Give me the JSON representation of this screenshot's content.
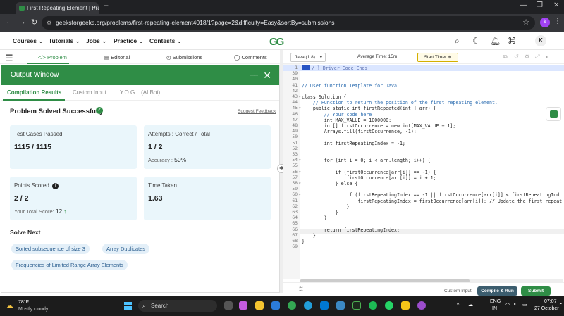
{
  "browser": {
    "tab_title": "First Repeating Element | Practi",
    "url": "geeksforgeeks.org/problems/first-repeating-element4018/1?page=2&difficulty=Easy&sortBy=submissions",
    "profile_initial": "k"
  },
  "site": {
    "logo": "GG",
    "nav": [
      "Courses",
      "Tutorials",
      "Jobs",
      "Practice",
      "Contests"
    ],
    "avatar_initial": "K"
  },
  "problem_tabs": [
    "Problem",
    "Editorial",
    "Submissions",
    "Comments"
  ],
  "output": {
    "title": "Output Window",
    "tabs": [
      "Compilation Results",
      "Custom Input",
      "Y.O.G.I. (AI Bot)"
    ],
    "status": "Problem Solved Successfully",
    "feedback": "Suggest Feedback",
    "cards": {
      "tests_label": "Test Cases Passed",
      "tests_value": "1115 / 1115",
      "attempts_label": "Attempts : Correct / Total",
      "attempts_value": "1 / 2",
      "accuracy_label": "Accuracy :",
      "accuracy_value": "50%",
      "points_label": "Points Scored",
      "points_value": "2 / 2",
      "total_label": "Your Total Score:",
      "total_value": "12",
      "time_label": "Time Taken",
      "time_value": "1.63"
    },
    "solve_next_title": "Solve Next",
    "solve_next": [
      "Sorted subsequence of size 3",
      "Array Duplicates",
      "Frequencies of Limited Range Array Elements"
    ]
  },
  "editor": {
    "language": "Java (1.8)",
    "avg_time": "Average Time: 15m",
    "timer_label": "Start Timer",
    "lines": [
      {
        "n": "1",
        "t": "/ } Driver Code Ends"
      },
      {
        "n": "39",
        "t": ""
      },
      {
        "n": "40",
        "t": ""
      },
      {
        "n": "41",
        "t": "// User function Template for Java"
      },
      {
        "n": "42",
        "t": ""
      },
      {
        "n": "43",
        "t": "class Solution {"
      },
      {
        "n": "44",
        "t": "    // Function to return the position of the first repeating element."
      },
      {
        "n": "45",
        "t": "    public static int firstRepeated(int[] arr) {"
      },
      {
        "n": "46",
        "t": "        // Your code here"
      },
      {
        "n": "47",
        "t": "        int MAX_VALUE = 1000000;"
      },
      {
        "n": "48",
        "t": "        int[] firstOccurrence = new int[MAX_VALUE + 1];"
      },
      {
        "n": "49",
        "t": "        Arrays.fill(firstOccurrence, -1);"
      },
      {
        "n": "50",
        "t": ""
      },
      {
        "n": "51",
        "t": "        int firstRepeatingIndex = -1;"
      },
      {
        "n": "52",
        "t": ""
      },
      {
        "n": "53",
        "t": ""
      },
      {
        "n": "54",
        "t": "        for (int i = 0; i < arr.length; i++) {"
      },
      {
        "n": "55",
        "t": ""
      },
      {
        "n": "56",
        "t": "            if (firstOccurrence[arr[i]] == -1) {"
      },
      {
        "n": "57",
        "t": "                firstOccurrence[arr[i]] = i + 1;"
      },
      {
        "n": "58",
        "t": "            } else {"
      },
      {
        "n": "59",
        "t": ""
      },
      {
        "n": "60",
        "t": "                if (firstRepeatingIndex == -1 || firstOccurrence[arr[i]] < firstRepeatingInd"
      },
      {
        "n": "61",
        "t": "                    firstRepeatingIndex = firstOccurrence[arr[i]]; // Update the first repeat"
      },
      {
        "n": "62",
        "t": "                }"
      },
      {
        "n": "63",
        "t": "            }"
      },
      {
        "n": "64",
        "t": "        }"
      },
      {
        "n": "65",
        "t": ""
      },
      {
        "n": "66",
        "t": "        return firstRepeatingIndex;"
      },
      {
        "n": "67",
        "t": "    }"
      },
      {
        "n": "68",
        "t": "}"
      },
      {
        "n": "69",
        "t": ""
      }
    ],
    "custom_input": "Custom Input",
    "compile_label": "Compile & Run",
    "submit_label": "Submit"
  },
  "taskbar": {
    "temp": "78°F",
    "weather": "Mostly cloudy",
    "search": "Search",
    "lang": "ENG",
    "region": "IN",
    "time": "07:07",
    "date": "27 October"
  },
  "colors": {
    "brand": "#2f8d46",
    "compile": "#3c5d6e"
  }
}
